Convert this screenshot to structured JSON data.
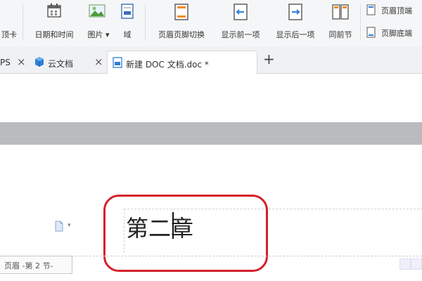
{
  "ribbon": {
    "partial_tab_label": "顶卡",
    "date_time_label": "日期和时间",
    "picture_label": "图片",
    "field_label": "域",
    "switch_header_footer_label": "页眉页脚切换",
    "show_previous_label": "显示前一项",
    "show_next_label": "显示后一项",
    "same_as_previous_label": "同前节",
    "header_top_label": "页眉顶端",
    "footer_bottom_label": "页脚底端"
  },
  "tabs": {
    "partial_tab_label": "PS",
    "cloud_doc_label": "云文档",
    "active_doc_label": "新建 DOC 文档.doc *",
    "close_glyph": "×",
    "new_tab_glyph": "+"
  },
  "document": {
    "heading_text": "第二章",
    "header_tag_label": "页眉 -第 2 节-"
  },
  "colors": {
    "highlight_ring": "#d4202b",
    "accent_blue": "#2f7fd6",
    "accent_orange": "#f08a24"
  }
}
